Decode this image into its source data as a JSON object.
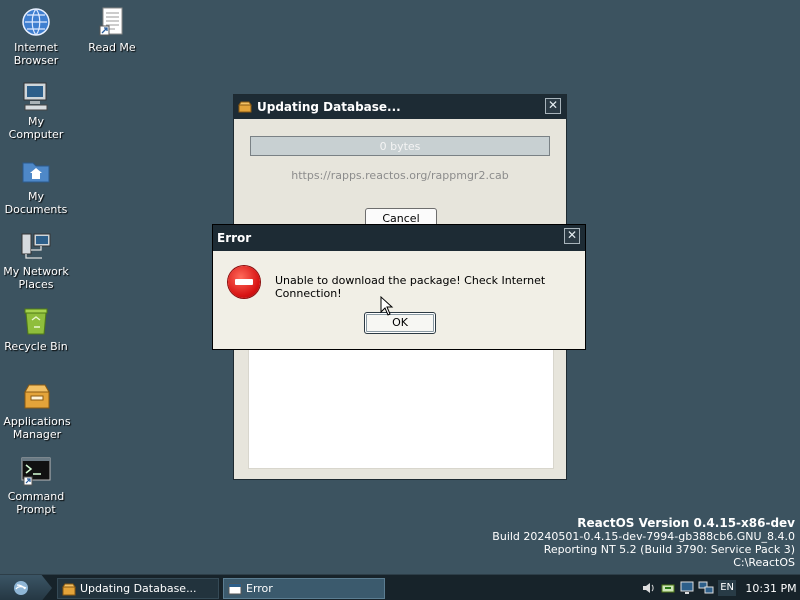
{
  "desktop": {
    "icons": [
      {
        "label": "Internet\nBrowser"
      },
      {
        "label": "Read Me"
      },
      {
        "label": "My\nComputer"
      },
      {
        "label": "My\nDocuments"
      },
      {
        "label": "My Network\nPlaces"
      },
      {
        "label": "Recycle Bin"
      },
      {
        "label": "Applications\nManager"
      },
      {
        "label": "Command\nPrompt"
      }
    ]
  },
  "updating_window": {
    "title": "Updating Database...",
    "close_glyph": "✕",
    "progress": {
      "text": "0 bytes",
      "fraction": 0
    },
    "url": "https://rapps.reactos.org/rappmgr2.cab",
    "cancel_label": "Cancel"
  },
  "error_dialog": {
    "title": "Error",
    "close_glyph": "✕",
    "message": "Unable to download the package! Check Internet Connection!",
    "ok_label": "OK",
    "icon": "error-stop-icon"
  },
  "version_info": {
    "title": "ReactOS Version 0.4.15-x86-dev",
    "build": "Build 20240501-0.4.15-dev-7994-gb388cb6.GNU_8.4.0",
    "reporting": "Reporting NT 5.2 (Build 3790: Service Pack 3)",
    "path": "C:\\ReactOS"
  },
  "taskbar": {
    "tasks": [
      {
        "label": "Updating Database..."
      },
      {
        "label": "Error"
      }
    ],
    "tray": {
      "language": "EN",
      "clock": "10:31 PM"
    }
  }
}
